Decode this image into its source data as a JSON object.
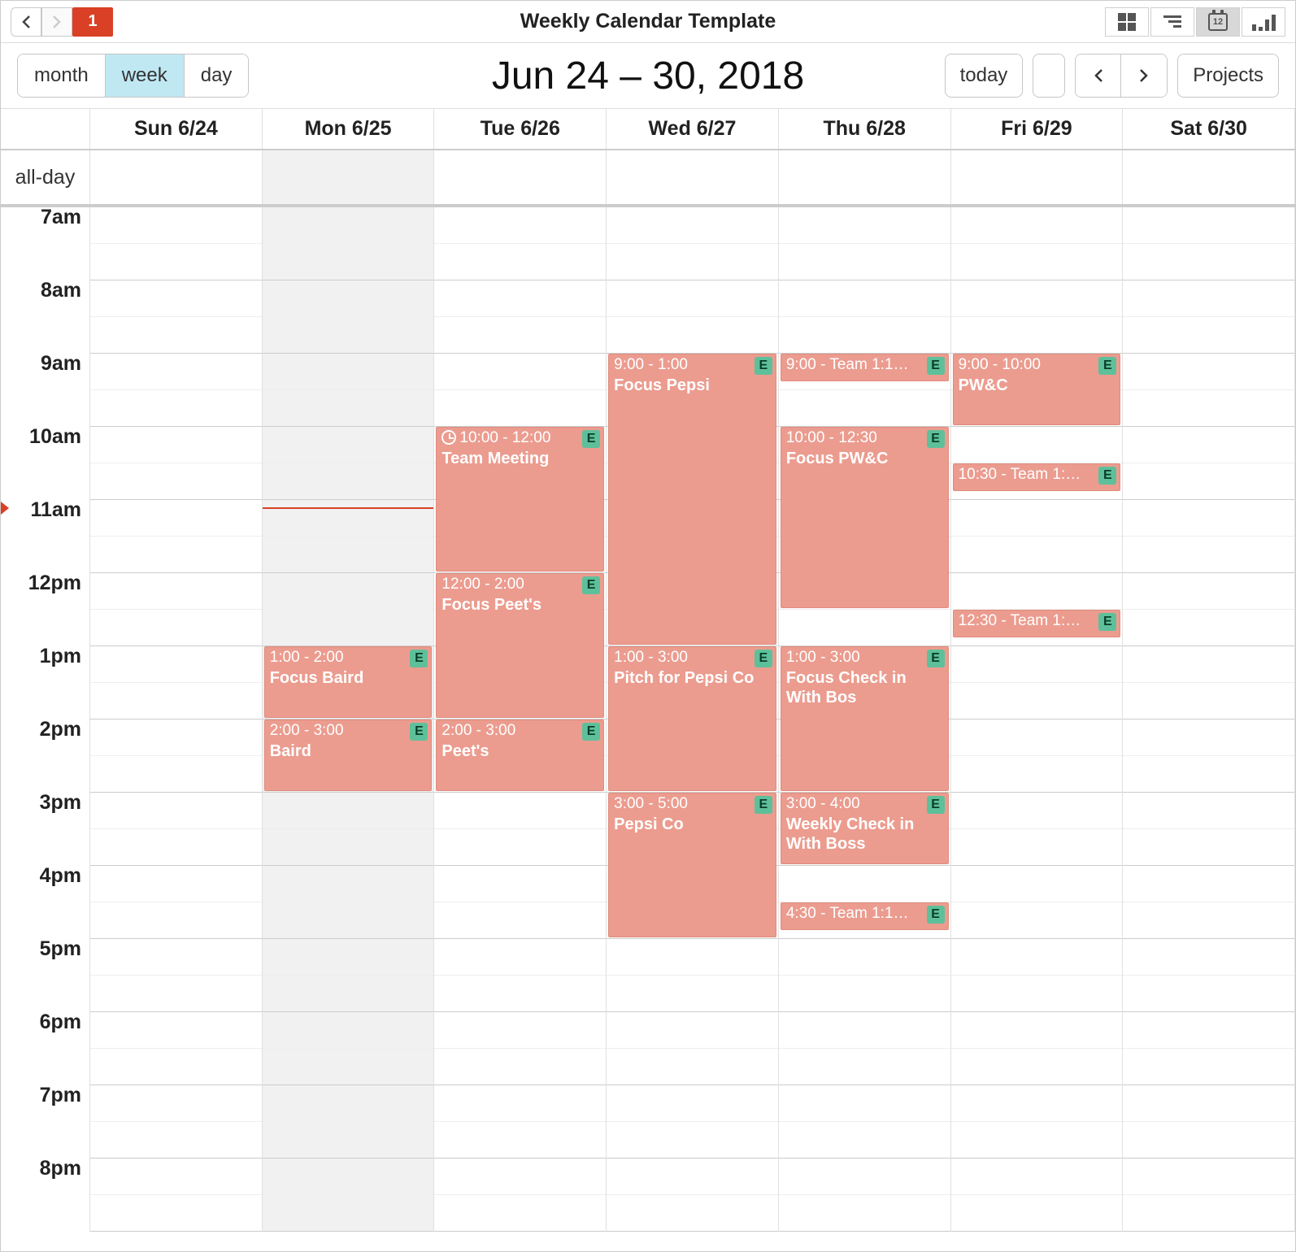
{
  "toolbar": {
    "title": "Weekly Calendar Template",
    "badge": "1",
    "cal_icon_num": "12"
  },
  "controls": {
    "month": "month",
    "week": "week",
    "day": "day",
    "today": "today",
    "projects": "Projects",
    "date_range": "Jun 24 – 30, 2018"
  },
  "days": [
    "",
    "Sun 6/24",
    "Mon 6/25",
    "Tue 6/26",
    "Wed 6/27",
    "Thu 6/28",
    "Fri 6/29",
    "Sat 6/30"
  ],
  "allday_label": "all-day",
  "today_index": 1,
  "hours": [
    "7am",
    "8am",
    "9am",
    "10am",
    "11am",
    "12pm",
    "1pm",
    "2pm",
    "3pm",
    "4pm",
    "5pm",
    "6pm",
    "7pm",
    "8pm"
  ],
  "now_hour_offset": 4.1,
  "events": {
    "mon": [
      {
        "start": 6,
        "end": 7,
        "time": "1:00 - 2:00",
        "title": "Focus Baird",
        "badge": "E"
      },
      {
        "start": 7,
        "end": 8,
        "time": "2:00 - 3:00",
        "title": "Baird",
        "badge": "E"
      }
    ],
    "tue": [
      {
        "start": 3,
        "end": 5,
        "time": "10:00 - 12:00",
        "title": "Team Meeting",
        "badge": "E",
        "clock": true
      },
      {
        "start": 5,
        "end": 7,
        "time": "12:00 - 2:00",
        "title": "Focus Peet's",
        "badge": "E"
      },
      {
        "start": 7,
        "end": 8,
        "time": "2:00 - 3:00",
        "title": "Peet's",
        "badge": "E"
      }
    ],
    "wed": [
      {
        "start": 2,
        "end": 6,
        "time": "9:00 - 1:00",
        "title": "Focus Pepsi",
        "badge": "E"
      },
      {
        "start": 6,
        "end": 8,
        "time": "1:00 - 3:00",
        "title": "Pitch for Pepsi Co",
        "badge": "E"
      },
      {
        "start": 8,
        "end": 10,
        "time": "3:00 - 5:00",
        "title": "Pepsi Co",
        "badge": "E"
      }
    ],
    "thu": [
      {
        "start": 2,
        "end": 2.4,
        "time": "9:00 -  Team 1:1…",
        "title": "",
        "badge": "E",
        "compact": true
      },
      {
        "start": 3,
        "end": 5.5,
        "time": "10:00 - 12:30",
        "title": "Focus PW&C",
        "badge": "E"
      },
      {
        "start": 6,
        "end": 8,
        "time": "1:00 - 3:00",
        "title": "Focus Check in With Bos",
        "badge": "E"
      },
      {
        "start": 8,
        "end": 9,
        "time": "3:00 - 4:00",
        "title": "Weekly Check in With Boss",
        "badge": "E"
      },
      {
        "start": 9.5,
        "end": 9.9,
        "time": "4:30 -  Team 1:1…",
        "title": "",
        "badge": "E",
        "compact": true
      }
    ],
    "fri": [
      {
        "start": 2,
        "end": 3,
        "time": "9:00 - 10:00",
        "title": "PW&C",
        "badge": "E"
      },
      {
        "start": 3.5,
        "end": 3.9,
        "time": "10:30 -  Team 1:…",
        "title": "",
        "badge": "E",
        "compact": true
      },
      {
        "start": 5.5,
        "end": 5.9,
        "time": "12:30 -  Team 1:…",
        "title": "",
        "badge": "E",
        "compact": true
      }
    ]
  }
}
